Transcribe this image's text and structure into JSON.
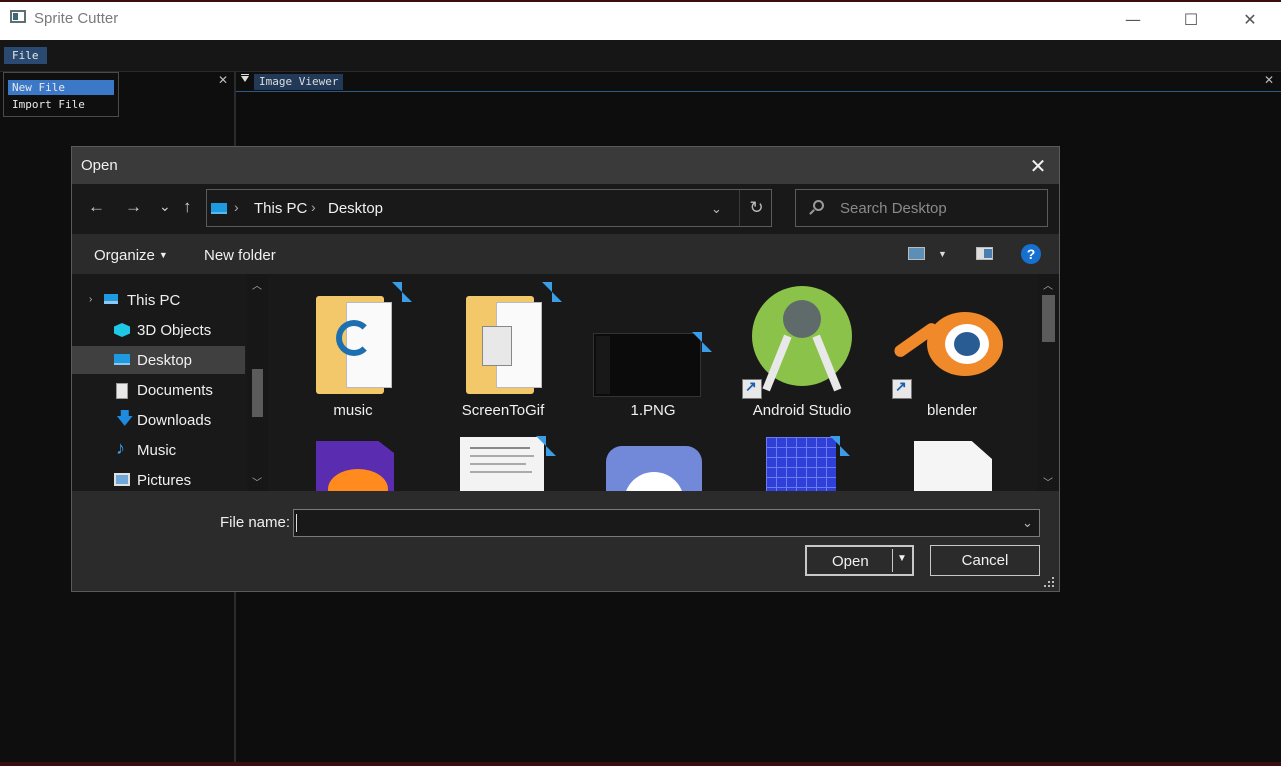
{
  "window": {
    "title": "Sprite Cutter",
    "controls": {
      "minimize": "—",
      "maximize": "☐",
      "close": "✕"
    }
  },
  "menubar": {
    "file": "File"
  },
  "file_menu": {
    "items": [
      "New File",
      "Import File"
    ],
    "selected": "New File"
  },
  "panels": {
    "left_close": "✕",
    "right_tab": "Image Viewer",
    "right_close": "✕"
  },
  "dialog": {
    "title": "Open",
    "close": "✕",
    "nav": {
      "back": "←",
      "forward": "→",
      "recent": "⌄",
      "up": "↑"
    },
    "breadcrumb": [
      "This PC",
      "Desktop"
    ],
    "refresh": "↻",
    "search_placeholder": "Search Desktop",
    "toolbar": {
      "organize": "Organize",
      "new_folder": "New folder",
      "help": "?"
    },
    "nav_pane": [
      {
        "label": "This PC",
        "icon": "pc-icon"
      },
      {
        "label": "3D Objects",
        "icon": "cube-icon"
      },
      {
        "label": "Desktop",
        "icon": "desktop-icon",
        "selected": true
      },
      {
        "label": "Documents",
        "icon": "documents-icon"
      },
      {
        "label": "Downloads",
        "icon": "download-icon"
      },
      {
        "label": "Music",
        "icon": "music-note-icon"
      },
      {
        "label": "Pictures",
        "icon": "pictures-icon"
      }
    ],
    "files": [
      {
        "label": "music",
        "icon": "folder-icon"
      },
      {
        "label": "ScreenToGif",
        "icon": "folder-icon"
      },
      {
        "label": "1.PNG",
        "icon": "image-thumbnail-icon"
      },
      {
        "label": "Android Studio",
        "icon": "android-studio-icon"
      },
      {
        "label": "blender",
        "icon": "blender-icon"
      }
    ],
    "file_name_label": "File name:",
    "file_name_value": "",
    "open_button": "Open",
    "cancel_button": "Cancel"
  },
  "colors": {
    "accent": "#3b78c8",
    "dialog_bg": "#2b2b2b",
    "pane_bg": "#191919"
  }
}
